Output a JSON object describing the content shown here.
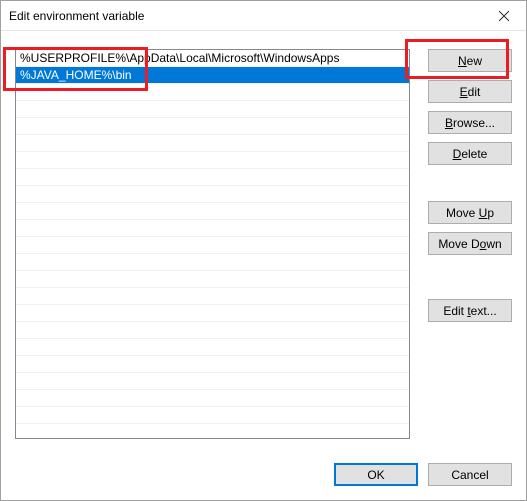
{
  "window": {
    "title": "Edit environment variable"
  },
  "list": {
    "items": [
      {
        "text": "%USERPROFILE%\\AppData\\Local\\Microsoft\\WindowsApps",
        "selected": false
      },
      {
        "text": "%JAVA_HOME%\\bin",
        "selected": true
      }
    ]
  },
  "buttons": {
    "new": "New",
    "edit": "Edit",
    "browse": "Browse...",
    "delete": "Delete",
    "moveup": "Move Up",
    "movedown": "Move Down",
    "edittext": "Edit text...",
    "ok": "OK",
    "cancel": "Cancel"
  }
}
